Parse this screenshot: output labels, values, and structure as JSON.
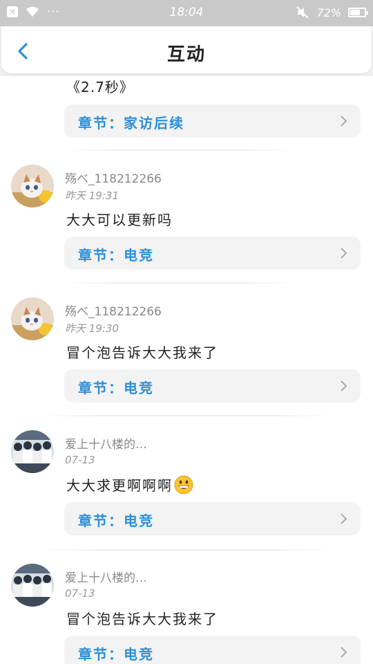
{
  "status_bar": {
    "time": "18:04",
    "battery": "72%",
    "battery_level": 0.72
  },
  "header": {
    "title": "互动",
    "back_icon": "chevron-left-icon"
  },
  "feed": {
    "partial_text": "《2.7秒》",
    "partial_chapter": "章节：家访后续",
    "comments": [
      {
        "username": "殇べ_118212266",
        "timestamp": "昨天 19:31",
        "text": "大大可以更新吗",
        "chapter": "章节：电竞",
        "avatar": "cat-avatar"
      },
      {
        "username": "殇べ_118212266",
        "timestamp": "昨天 19:30",
        "text": "冒个泡告诉大大我来了",
        "chapter": "章节：电竞",
        "avatar": "cat-avatar"
      },
      {
        "username": "爱上十八楼的…",
        "timestamp": "07-13",
        "text": "大大求更啊啊啊",
        "emoji": "grinning-face-emoji",
        "chapter": "章节：电竞",
        "avatar": "group-photo-avatar"
      },
      {
        "username": "爱上十八楼的…",
        "timestamp": "07-13",
        "text": "冒个泡告诉大大我来了",
        "chapter": "章节：电竞",
        "avatar": "group-photo-avatar"
      }
    ]
  },
  "colors": {
    "accent": "#2c8fd8",
    "status_bar": "#c9c9c9",
    "chapter_bg": "#f3f3f3"
  }
}
